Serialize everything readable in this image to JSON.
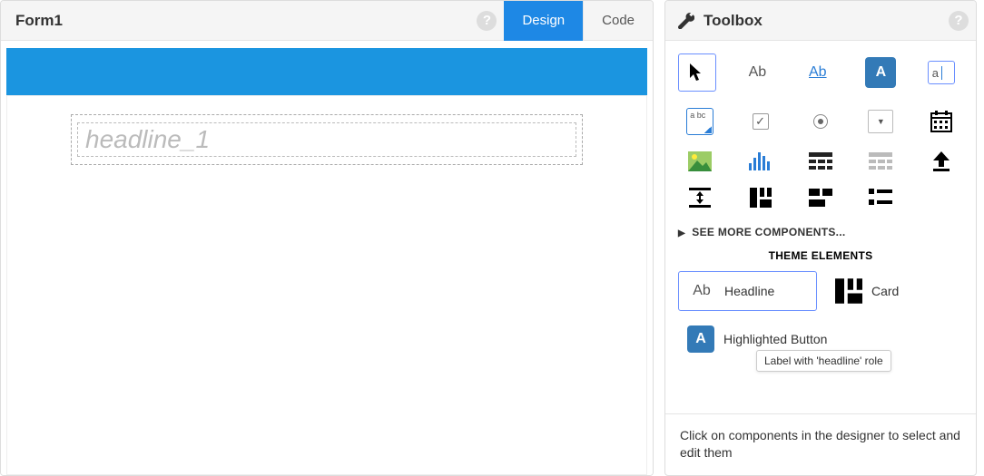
{
  "form": {
    "title": "Form1",
    "tabs": {
      "design": "Design",
      "code": "Code"
    },
    "headline_placeholder": "headline_1"
  },
  "toolbox": {
    "title": "Toolbox",
    "tools": {
      "label": "Ab",
      "link": "Ab",
      "button": "A",
      "input": "a",
      "textarea": "a\nbc"
    },
    "see_more": "SEE MORE COMPONENTS...",
    "theme_title": "THEME ELEMENTS",
    "theme": {
      "headline": "Headline",
      "card": "Card",
      "highlighted_button": "Highlighted Button"
    },
    "tooltip": "Label with 'headline' role",
    "footer": "Click on components in the designer to select and edit them"
  }
}
